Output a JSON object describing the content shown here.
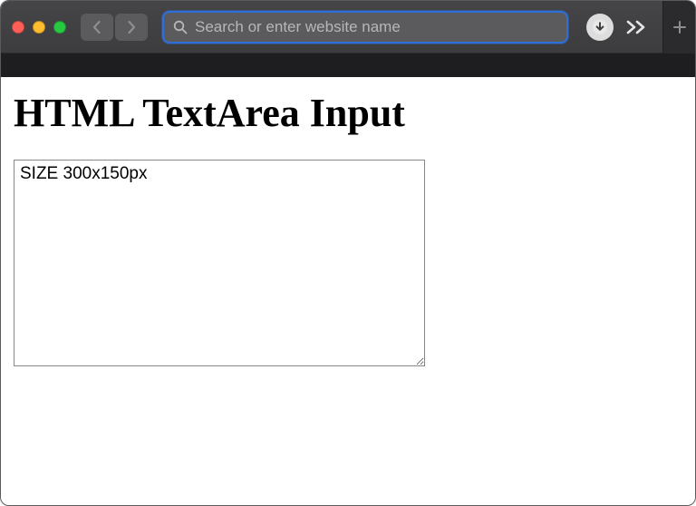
{
  "browser": {
    "search_placeholder": "Search or enter website name",
    "search_value": "",
    "icons": {
      "close": "close",
      "minimize": "minimize",
      "zoom": "zoom",
      "back": "back",
      "forward": "forward",
      "search": "search",
      "download": "download",
      "overflow": "overflow",
      "new_tab": "new-tab"
    }
  },
  "page": {
    "title": "HTML TextArea Input",
    "textarea_value": "SIZE 300x150px"
  }
}
